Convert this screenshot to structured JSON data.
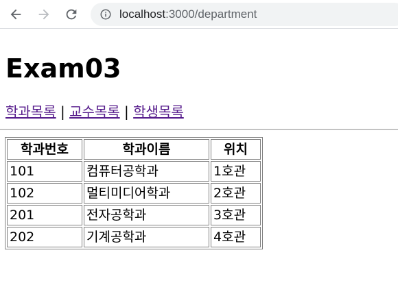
{
  "browser": {
    "url_host": "localhost",
    "url_path": ":3000/department"
  },
  "page": {
    "title": "Exam03",
    "nav_links": [
      {
        "label": "학과목록"
      },
      {
        "label": "교수목록"
      },
      {
        "label": "학생목록"
      }
    ],
    "separator": "|"
  },
  "table": {
    "headers": [
      "학과번호",
      "학과이름",
      "위치"
    ],
    "rows": [
      [
        "101",
        "컴퓨터공학과",
        "1호관"
      ],
      [
        "102",
        "멀티미디어학과",
        "2호관"
      ],
      [
        "201",
        "전자공학과",
        "3호관"
      ],
      [
        "202",
        "기계공학과",
        "4호관"
      ]
    ]
  },
  "colors": {
    "link_visited": "#551a8b",
    "address_bar_bg": "#f1f3f4",
    "table_border": "#808080"
  }
}
